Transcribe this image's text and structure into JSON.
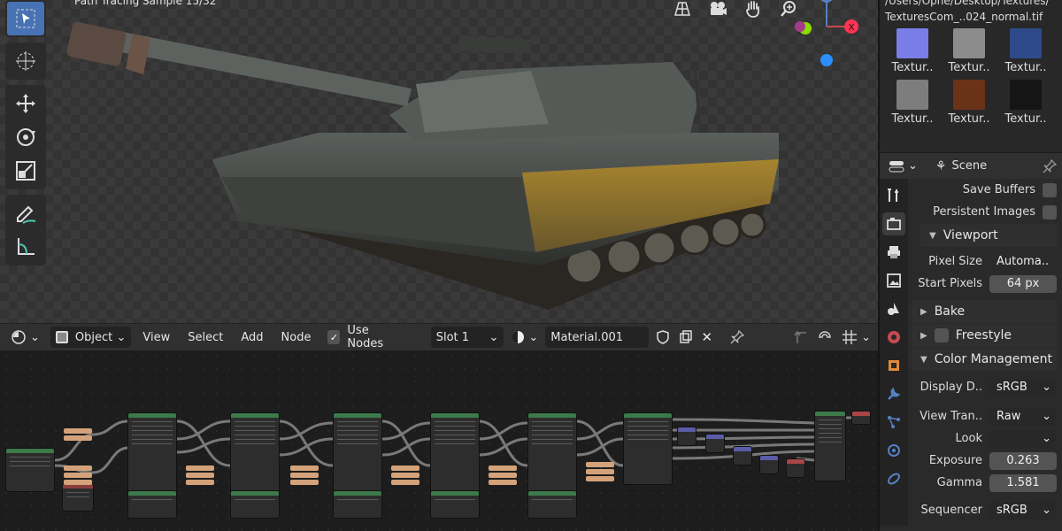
{
  "viewport": {
    "status": "Path Tracing Sample 15/32",
    "tools": [
      "select-box",
      "cursor",
      "move",
      "rotate",
      "scale",
      "annotate",
      "measure"
    ],
    "gizmo": {
      "z": "Z",
      "x": "X"
    }
  },
  "node_header": {
    "mode": "Object",
    "menus": [
      "View",
      "Select",
      "Add",
      "Node"
    ],
    "use_nodes_label": "Use Nodes",
    "slot": "Slot 1",
    "material": "Material.001"
  },
  "textures": {
    "path": "/Users/Opne/Desktop/Textures/",
    "current": "TexturesCom_..024_normal.tif",
    "items": [
      {
        "label": "Textur..",
        "color": "#7a7de8"
      },
      {
        "label": "Textur..",
        "color": "#8c8c8c"
      },
      {
        "label": "Textur..",
        "color": "#2e4a8a"
      },
      {
        "label": "Textur..",
        "color": "#7d7d7d"
      },
      {
        "label": "Textur..",
        "color": "#6a3318"
      },
      {
        "label": "Textur..",
        "color": "#151515"
      }
    ]
  },
  "properties": {
    "context": "Scene",
    "save_buffers": "Save Buffers",
    "persistent_images": "Persistent Images",
    "viewport_section": "Viewport",
    "pixel_size_label": "Pixel Size",
    "pixel_size_value": "Automa..",
    "start_pixels_label": "Start Pixels",
    "start_pixels_value": "64 px",
    "bake": "Bake",
    "freestyle": "Freestyle",
    "color_management": "Color Management",
    "display_label": "Display D..",
    "display_value": "sRGB",
    "view_label": "View Tran..",
    "view_value": "Raw",
    "look_label": "Look",
    "look_value": "",
    "exposure_label": "Exposure",
    "exposure_value": "0.263",
    "gamma_label": "Gamma",
    "gamma_value": "1.581",
    "sequencer_label": "Sequencer",
    "sequencer_value": "sRGB"
  },
  "colors": {
    "accent": "#4772b3",
    "node_header": "#3c7a4a"
  }
}
